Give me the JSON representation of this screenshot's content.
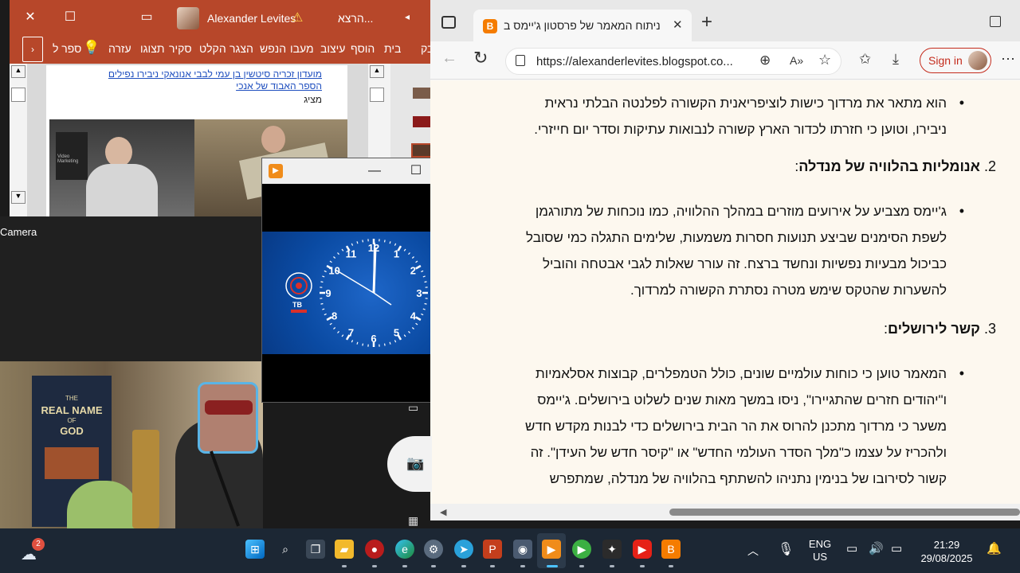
{
  "powerpoint": {
    "title_user": "Alexander Levites",
    "title_doc": "...הרצא",
    "tabs": [
      "ספר ל",
      "עזרה",
      "תצוגו",
      "סקיר",
      "הקלט",
      "הצגר",
      "הנפש",
      "מעבו",
      "עיצוב",
      "הוסף",
      "בית",
      "בק"
    ],
    "slide_link_line1": "מועדון זכריה סיטשין בן עמי לבבי אנונאקי ניבירו נפילים",
    "slide_link_line2": "הספר האבוד של אנכי",
    "slide_caption": "מציג",
    "video_tag": "Video Marketing"
  },
  "camera": {
    "label": "Camera"
  },
  "player": {
    "clock_numbers": [
      "12",
      "1",
      "2",
      "3",
      "4",
      "5",
      "6",
      "7",
      "8",
      "9",
      "10",
      "11"
    ],
    "logo_text": "TB"
  },
  "edge": {
    "tab_title": "ניתוח המאמר של פרסטון ג'יימס ב",
    "url": "https://alexanderlevites.blogspot.co...",
    "signin_label": "Sign in",
    "article": {
      "p1_line1": "הוא מתאר את מרדוך כישות לוציפריאנית הקשורה לפלנטה הבלתי נראית",
      "p1_line2": "ניבירו, וטוען כי חזרתו לכדור הארץ קשורה לנבואות עתיקות וסדר יום חייזרי.",
      "h2_num": "2.",
      "h2_text": "אנומליות בהלוויה של מנדלה",
      "h2_colon": ":",
      "p2_line1": "ג'יימס מצביע על אירועים מוזרים במהלך ההלוויה, כמו נוכחות של מתורגמן",
      "p2_line2": "לשפת הסימנים שביצע תנועות חסרות משמעות, שלימים התגלה כמי שסובל",
      "p2_line3": "כביכול מבעיות נפשיות ונחשד ברצח. זה עורר שאלות לגבי אבטחה והוביל",
      "p2_line4": "להשערות שהטקס שימש מטרה נסתרת הקשורה למרדוך.",
      "h3_num": "3.",
      "h3_text": "קשר לירושלים",
      "h3_colon": ":",
      "p3_line1": "המאמר טוען כי כוחות עולמיים שונים, כולל הטמפלרים, קבוצות אסלאמיות",
      "p3_line2": "ו\"יהודים חזרים שהתגיירו\", ניסו במשך מאות שנים לשלוט בירושלים. ג'יימס",
      "p3_line3": "משער כי מרדוך מתכנן להרוס את הר הבית בירושלים כדי לבנות מקדש חדש",
      "p3_line4": "ולהכריז על עצמו כ\"מלך הסדר העולמי החדש\" או \"קיסר חדש של העידן\". זה",
      "p3_line5": "קשור לסירובו של בנימין נתניהו להשתתף בהלוויה של מנדלה, שמתפרש"
    }
  },
  "book": {
    "line1": "THE",
    "line2": "REAL NAME",
    "line3": "OF",
    "line4": "GOD"
  },
  "taskbar": {
    "weather_badge": "2",
    "lang_line1": "ENG",
    "lang_line2": "US",
    "time": "21:29",
    "date": "29/08/2025"
  },
  "colors": {
    "ppt_red": "#b7472a",
    "link_blue": "#1f4fbf",
    "taskbar_bg": "#1c2734",
    "signin_red": "#c42b1c"
  }
}
